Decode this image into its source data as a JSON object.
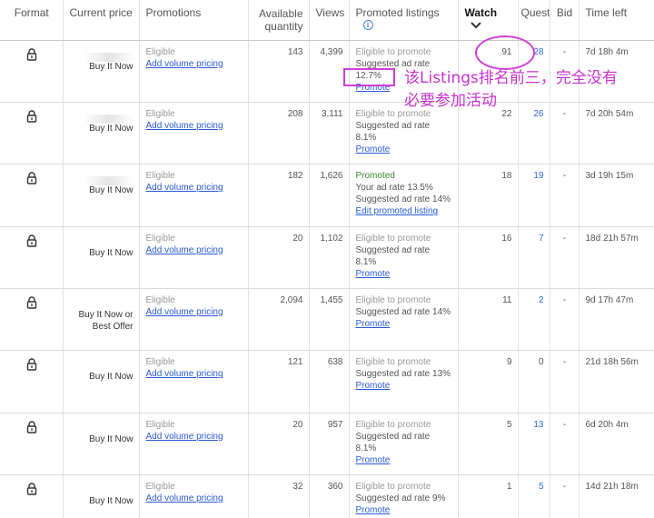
{
  "columns": {
    "format": "Format",
    "current_price": "Current price",
    "promotions": "Promotions",
    "available_quantity": "Available quantity",
    "views": "Views",
    "promoted_listings": "Promoted listings",
    "watch": "Watch",
    "questions": "Question",
    "bid": "Bid",
    "time_left": "Time left"
  },
  "icons": {
    "format": "lock-icon",
    "sort": "chevron-down-icon",
    "info": "info-icon"
  },
  "rows": [
    {
      "price": "Buy It Now",
      "promo_status": "Eligible",
      "promo_link": "Add volume pricing",
      "qty": "143",
      "views": "4,399",
      "pl_line1": "Eligible to promote",
      "pl_line2": "Suggested ad rate 12.7%",
      "pl_line3": "",
      "pl_link": "Promote",
      "watch": "91",
      "questions": "28",
      "bid": "-",
      "time_left": "7d 18h 4m"
    },
    {
      "price": "Buy It Now",
      "promo_status": "Eligible",
      "promo_link": "Add volume pricing",
      "qty": "208",
      "views": "3,111",
      "pl_line1": "Eligible to promote",
      "pl_line2": "Suggested ad rate 8.1%",
      "pl_line3": "",
      "pl_link": "Promote",
      "watch": "22",
      "questions": "26",
      "bid": "-",
      "time_left": "7d 20h 54m"
    },
    {
      "price": "Buy It Now",
      "promo_status": "Eligible",
      "promo_link": "Add volume pricing",
      "qty": "182",
      "views": "1,626",
      "pl_line1": "Promoted",
      "pl_line2": "Your ad rate 13.5%",
      "pl_line3": "Suggested ad rate 14%",
      "pl_link": "Edit promoted listing",
      "watch": "18",
      "questions": "19",
      "bid": "-",
      "time_left": "3d 19h 15m"
    },
    {
      "price": "Buy It Now",
      "promo_status": "Eligible",
      "promo_link": "Add volume pricing",
      "qty": "20",
      "views": "1,102",
      "pl_line1": "Eligible to promote",
      "pl_line2": "Suggested ad rate 8.1%",
      "pl_line3": "",
      "pl_link": "Promote",
      "watch": "16",
      "questions": "7",
      "bid": "-",
      "time_left": "18d 21h 57m"
    },
    {
      "price": "Buy It Now or Best Offer",
      "promo_status": "Eligible",
      "promo_link": "Add volume pricing",
      "qty": "2,094",
      "views": "1,455",
      "pl_line1": "Eligible to promote",
      "pl_line2": "Suggested ad rate 14%",
      "pl_line3": "",
      "pl_link": "Promote",
      "watch": "11",
      "questions": "2",
      "bid": "-",
      "time_left": "9d 17h 47m"
    },
    {
      "price": "Buy It Now",
      "promo_status": "Eligible",
      "promo_link": "Add volume pricing",
      "qty": "121",
      "views": "638",
      "pl_line1": "Eligible to promote",
      "pl_line2": "Suggested ad rate 13%",
      "pl_line3": "",
      "pl_link": "Promote",
      "watch": "9",
      "questions": "0",
      "bid": "-",
      "time_left": "21d 18h 56m"
    },
    {
      "price": "Buy It Now",
      "promo_status": "Eligible",
      "promo_link": "Add volume pricing",
      "qty": "20",
      "views": "957",
      "pl_line1": "Eligible to promote",
      "pl_line2": "Suggested ad rate 8.1%",
      "pl_line3": "",
      "pl_link": "Promote",
      "watch": "5",
      "questions": "13",
      "bid": "-",
      "time_left": "6d 20h 4m"
    },
    {
      "price": "Buy It Now",
      "promo_status": "Eligible",
      "promo_link": "Add volume pricing",
      "qty": "32",
      "views": "360",
      "pl_line1": "Eligible to promote",
      "pl_line2": "Suggested ad rate 9%",
      "pl_line3": "",
      "pl_link": "Promote",
      "watch": "1",
      "questions": "5",
      "bid": "-",
      "time_left": "14d 21h 18m"
    }
  ],
  "annotation": {
    "text": "该Listings排名前三，完全没有\n必要参加活动",
    "color": "#d23dd6"
  },
  "colors": {
    "link": "#2a5bd7",
    "promoted": "#3a8a2e",
    "annotation": "#d23dd6"
  }
}
